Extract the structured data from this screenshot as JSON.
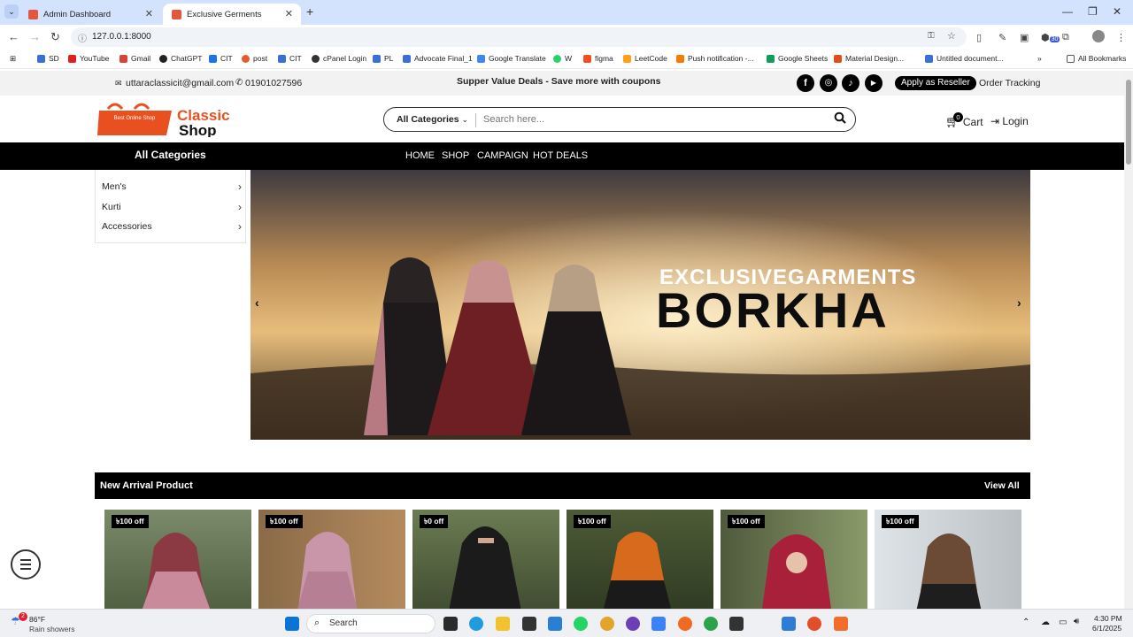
{
  "browser": {
    "tabs": [
      {
        "title": "Admin Dashboard"
      },
      {
        "title": "Exclusive Germents"
      }
    ],
    "url": "127.0.0.1:8000",
    "bookmarks": [
      "SD",
      "YouTube",
      "Gmail",
      "ChatGPT",
      "CIT",
      "post",
      "CIT",
      "cPanel Login",
      "PL",
      "Advocate Final_1",
      "Google Translate",
      "W",
      "figma",
      "LeetCode",
      "Push notification -...",
      "Google Sheets",
      "Material Design...",
      "Untitled document..."
    ],
    "all_bookmarks": "All Bookmarks",
    "ext_badge": "30"
  },
  "topbar": {
    "email": "uttaraclassicit@gmail.com",
    "phone": "01901027596",
    "promo": "Supper Value Deals - Save more with coupons",
    "reseller_button": "Apply as Reseller",
    "order_tracking": "Order Tracking"
  },
  "header": {
    "logo_line1": "Classic",
    "logo_line2": "Shop",
    "logo_bag_text": "Best Online Shop",
    "category_select": "All Categories",
    "search_placeholder": "Search here...",
    "cart_label": "Cart",
    "cart_count": "0",
    "login_label": "Login"
  },
  "navbar": {
    "all_categories": "All Categories",
    "menu": [
      "HOME",
      "SHOP",
      "CAMPAIGN",
      "HOT DEALS"
    ]
  },
  "sidebar": {
    "categories": [
      "Men's",
      "Kurti",
      "Accessories"
    ]
  },
  "banner": {
    "line1": "EXCLUSIVEGARMENTS",
    "line2": "BORKHA"
  },
  "new_arrival": {
    "title": "New Arrival Product",
    "view_all": "View All",
    "products": [
      {
        "badge": "৳100 off",
        "color": "#c98a9b"
      },
      {
        "badge": "৳100 off",
        "color": "#b77f93"
      },
      {
        "badge": "৳0 off",
        "color": "#1b1b1b"
      },
      {
        "badge": "৳100 off",
        "color": "#d86a1e"
      },
      {
        "badge": "৳100 off",
        "color": "#a8203a"
      },
      {
        "badge": "৳100 off",
        "color": "#6b4b36"
      }
    ]
  },
  "taskbar": {
    "weather_temp": "86°F",
    "weather_desc": "Rain showers",
    "weather_badge": "2",
    "search_label": "Search",
    "time": "4:30 PM",
    "date": "6/1/2025"
  },
  "colors": {
    "accent": "#000000",
    "topbar_bg": "#f2f2f2",
    "logo_orange": "#e8501f"
  }
}
